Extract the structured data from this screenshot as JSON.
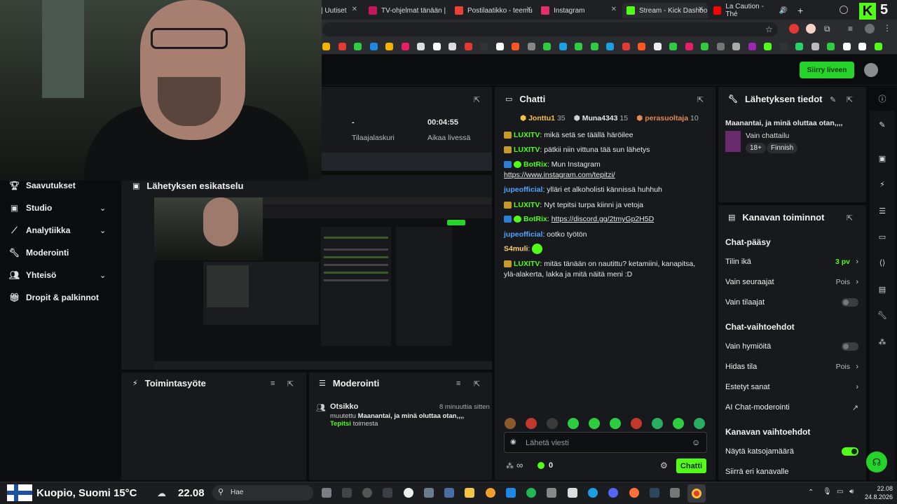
{
  "browser": {
    "tabs": [
      {
        "label": "| Uutiset"
      },
      {
        "label": "TV-ohjelmat tänään |"
      },
      {
        "label": "Postilaatikko - teemu"
      },
      {
        "label": "Instagram"
      },
      {
        "label": "Stream - Kick Dashbo"
      },
      {
        "label": "La Caution - Thé"
      }
    ],
    "new_tab": "+",
    "kick_badge": "5"
  },
  "header": {
    "go_live": "Siirry liveen"
  },
  "stream_stats": {
    "subs_value": "-",
    "subs_label": "Tilaajalaskuri",
    "time_value": "00:04:55",
    "time_label": "Aikaa livessä"
  },
  "nav": {
    "items": [
      {
        "label": "Saavutukset"
      },
      {
        "label": "Studio"
      },
      {
        "label": "Analytiikka"
      },
      {
        "label": "Moderointi"
      },
      {
        "label": "Yhteisö"
      },
      {
        "label": "Dropit & palkinnot"
      }
    ]
  },
  "preview": {
    "title": "Lähetyksen esikatselu"
  },
  "activity": {
    "title": "Toimintasyöte"
  },
  "moderation": {
    "title": "Moderointi",
    "entry_title": "Otsikko",
    "entry_time": "8 minuuttia sitten",
    "entry_text_pre": "muutettu ",
    "entry_text_bold": "Maanantai, ja minä oluttaa otan,,,,",
    "entry_user": "Tepitsi",
    "entry_text_post": "toimesta"
  },
  "chat": {
    "title": "Chatti",
    "leaders": [
      {
        "name": "Jonttu1",
        "count": "35"
      },
      {
        "name": "Muna4343",
        "count": "15"
      },
      {
        "name": "perasuoltaja",
        "count": "10"
      }
    ],
    "messages": [
      {
        "user": "LUXITV",
        "text": "mikä setä se täällä häröilee"
      },
      {
        "user": "LUXITV",
        "text": "pätkii niin vittuna tää sun lähetys"
      },
      {
        "user": "BotRix",
        "text": "Mun Instagram",
        "link": "https://www.instagram.com/tepitzi/"
      },
      {
        "user": "jupeofficial",
        "text": "ylläri et alkoholisti kännissä huhhuh"
      },
      {
        "user": "LUXITV",
        "text": "Nyt tepitsi turpa kiinni ja vetoja"
      },
      {
        "user": "BotRix",
        "link": "https://discord.gg/2tmyGp2H5D"
      },
      {
        "user": "jupeofficial",
        "text": "ootko työtön"
      },
      {
        "user": "S4muli"
      },
      {
        "user": "LUXITV",
        "text": "mitäs tänään on nautittu? ketamiini, kanapitsa, ylä-alakerta, lakka ja mitä näitä meni :D"
      }
    ],
    "input_placeholder": "Lähetä viesti",
    "points": "0",
    "send": "Chatti",
    "infinity": "∞"
  },
  "stream_info": {
    "title": "Lähetyksen tiedot",
    "stream_title": "Maanantai, ja minä oluttaa otan,,,,",
    "category": "Vain chattailu",
    "tags": [
      "18+",
      "Finnish"
    ]
  },
  "channel_actions": {
    "title": "Kanavan toiminnot",
    "chat_access": "Chat-pääsy",
    "account_age": "Tilin ikä",
    "account_age_val": "3 pv",
    "followers_only": "Vain seuraajat",
    "followers_only_val": "Pois",
    "subs_only": "Vain tilaajat",
    "chat_options": "Chat-vaihtoehdot",
    "emotes_only": "Vain hymiöitä",
    "slow_mode": "Hidas tila",
    "slow_mode_val": "Pois",
    "banned_words": "Estetyt sanat",
    "ai_moderation": "AI Chat-moderointi",
    "channel_options": "Kanavan vaihtoehdot",
    "show_viewers": "Näytä katsojamäärä",
    "switch_channel": "Siirrä eri kanavalle"
  },
  "taskbar": {
    "weather": "Kuopio, Suomi 15°C",
    "temp2": "22.08",
    "search": "Hae",
    "time": "22.08",
    "date": "24.8.2026"
  }
}
